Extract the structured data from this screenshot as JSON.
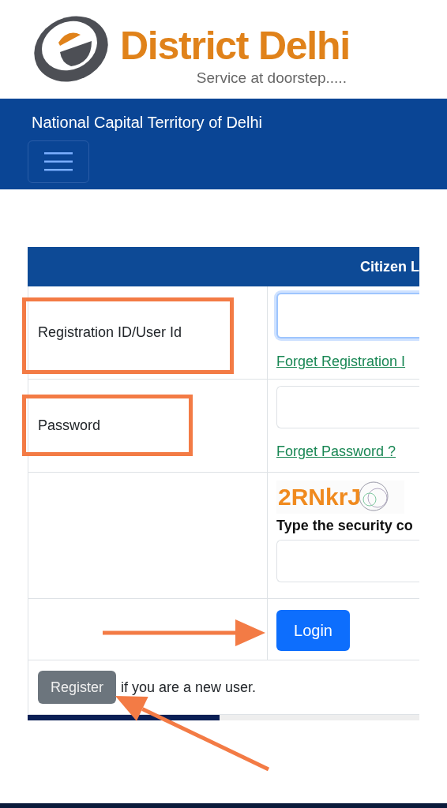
{
  "logo": {
    "title": "District Delhi",
    "tagline": "Service at doorstep....."
  },
  "navbar": {
    "title": "National Capital Territory of Delhi"
  },
  "login_table": {
    "heading": "Citizen L",
    "rows": [
      {
        "kind": "input",
        "label": "Registration ID/User Id",
        "focused": true,
        "link": "Forget Registration I"
      },
      {
        "kind": "input",
        "label": "Password",
        "focused": false,
        "link": "Forget Password ?"
      },
      {
        "kind": "captcha",
        "captcha": "2RNkrJ",
        "prompt": "Type the security co"
      },
      {
        "kind": "button",
        "button": "Login"
      }
    ],
    "register": {
      "button": "Register",
      "text": "if you are a new user."
    }
  }
}
